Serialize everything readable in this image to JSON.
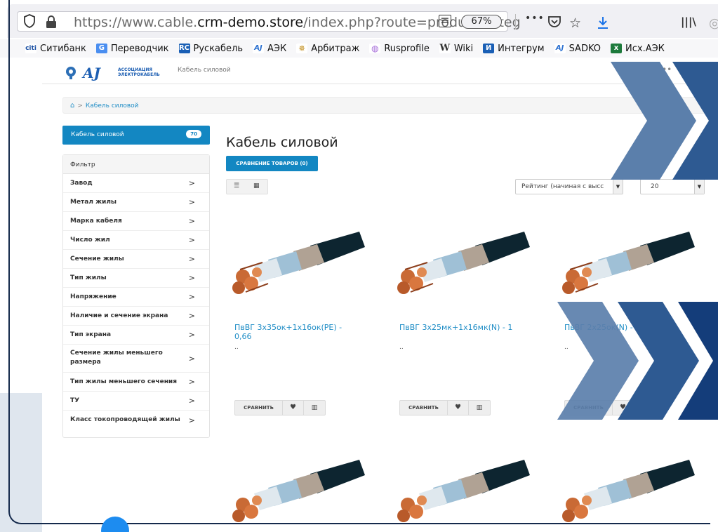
{
  "browser": {
    "url_prefix": "https://www.cable.",
    "url_domain": "crm-demo.store",
    "url_suffix": "/index.php?route=product/categ",
    "zoom": "67%",
    "more_dots": "•••"
  },
  "bookmarks": [
    {
      "icon": "citi",
      "label": "Ситибанк",
      "color": "#1a4fa3"
    },
    {
      "icon": "translate",
      "label": "Переводчик",
      "color": "#4a8ef0"
    },
    {
      "icon": "RC",
      "label": "Рускабель",
      "color": "#1a5fb5"
    },
    {
      "icon": "aek",
      "label": "АЭК",
      "color": "#2a6fd0"
    },
    {
      "icon": "eagle",
      "label": "Арбитраж",
      "color": "#c08b18"
    },
    {
      "icon": "rp",
      "label": "Rusprofile",
      "color": "#a46ad8"
    },
    {
      "icon": "W",
      "label": "Wiki",
      "color": "#333333"
    },
    {
      "icon": "И",
      "label": "Интегрум",
      "color": "#1a5fb5"
    },
    {
      "icon": "aek",
      "label": "SADKO",
      "color": "#2a6fd0"
    },
    {
      "icon": "x",
      "label": "Исх.АЭК",
      "color": "#1d7a3c"
    }
  ],
  "site": {
    "logo_text": "АССОЦИАЦИЯ ЭЛЕКТРОКАБЕЛЬ",
    "header_category": "Кабель силовой"
  },
  "breadcrumb": {
    "current": "Кабель силовой"
  },
  "sidebar": {
    "active_category": "Кабель силовой",
    "active_count": "70",
    "filter_title": "Фильтр",
    "filters": [
      "Завод",
      "Метал жилы",
      "Марка кабеля",
      "Число жил",
      "Сечение жилы",
      "Тип жилы",
      "Напряжение",
      "Наличие и сечение экрана",
      "Тип экрана",
      "Сечение жилы меньшего размера",
      "Тип жилы меньшего сечения",
      "ТУ",
      "Класс токопроводящей жилы"
    ]
  },
  "main": {
    "title": "Кабель силовой",
    "compare_button": "СРАВНЕНИЕ ТОВАРОВ (0)",
    "sort_value": "Рейтинг (начиная с высс",
    "limit_value": "20"
  },
  "products": [
    {
      "name": "ПвВГ 3х35ок+1х16ок(PE) - 0,66",
      "desc": "..",
      "compare": "СРАВНИТЬ"
    },
    {
      "name": "ПвВГ 3х25мк+1х16мк(N) - 1",
      "desc": "..",
      "compare": "СРАВНИТЬ"
    },
    {
      "name": "ПвВГ 2х25ок(N) - 1",
      "desc": "..",
      "compare": "СРАВНИТЬ"
    }
  ],
  "colors": {
    "accent": "#1387c2",
    "link": "#1f8dc6",
    "chevron_dark": "#143d7a",
    "chevron_mid": "#2e5a92",
    "chevron_light": "#5b7fab"
  }
}
